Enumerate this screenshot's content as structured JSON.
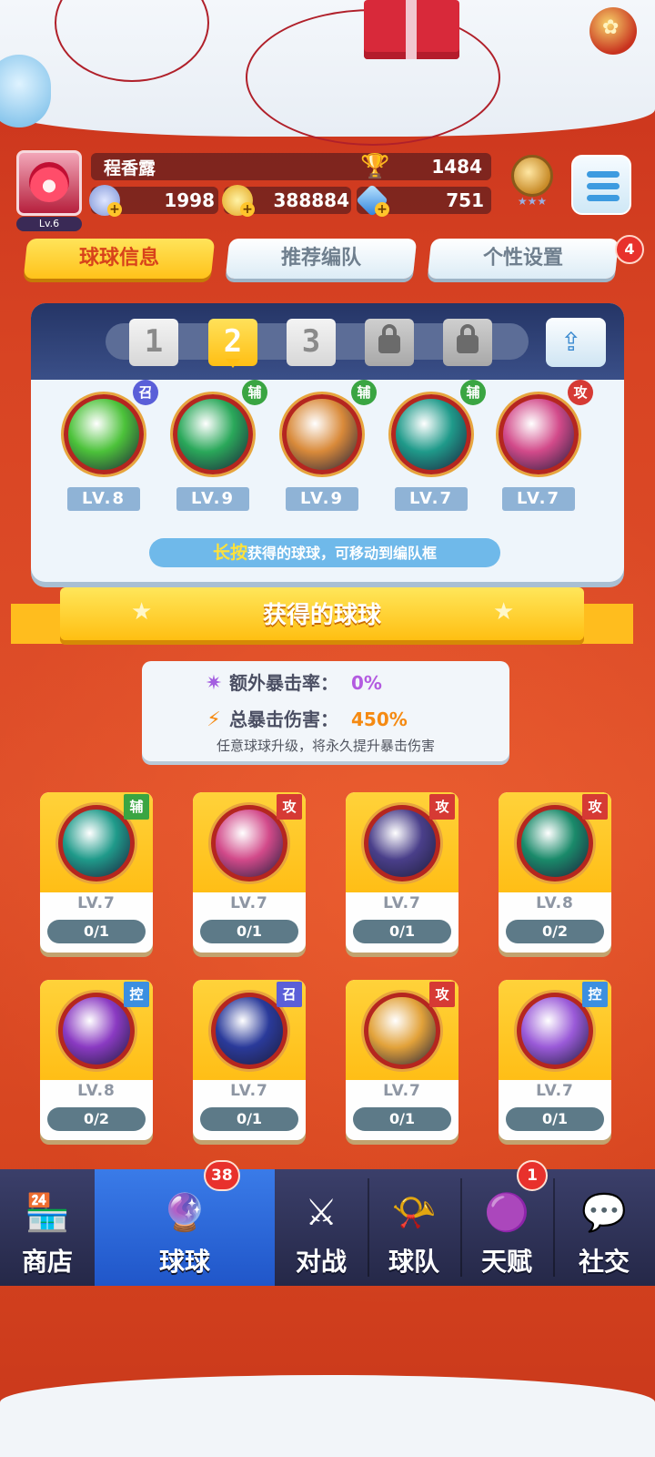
{
  "player": {
    "name": "程香露",
    "level": "Lv.6",
    "trophies": "1484"
  },
  "resources": [
    {
      "icon": "star-coin-icon",
      "value": "1998"
    },
    {
      "icon": "gold-coin-icon",
      "value": "388884"
    },
    {
      "icon": "diamond-icon",
      "value": "751"
    }
  ],
  "tabs": [
    {
      "label": "球球信息",
      "active": true
    },
    {
      "label": "推荐编队",
      "active": false
    },
    {
      "label": "个性设置",
      "active": false,
      "badge": "4"
    }
  ],
  "team": {
    "slots": [
      "1",
      "2",
      "3",
      "locked",
      "locked"
    ],
    "selected_slot": "2",
    "members": [
      {
        "role": "召",
        "level": "LV.8",
        "icon": "green-star-ball-icon",
        "color": "#4cc23a"
      },
      {
        "role": "辅",
        "level": "LV.9",
        "icon": "green-arrow-ball-icon",
        "color": "#2aa85a"
      },
      {
        "role": "辅",
        "level": "LV.9",
        "icon": "people-ball-icon",
        "color": "#d98a3a"
      },
      {
        "role": "辅",
        "level": "LV.7",
        "icon": "dragon-ball-icon",
        "color": "#1f9a8a"
      },
      {
        "role": "攻",
        "level": "LV.7",
        "icon": "prism-ball-icon",
        "color": "#d24a8a"
      }
    ],
    "hint_highlight": "长按",
    "hint_text": "获得的球球，可移动到编队框"
  },
  "section_title": "获得的球球",
  "crit": {
    "extra_rate_label": "额外暴击率：",
    "extra_rate_value": "0%",
    "total_damage_label": "总暴击伤害：",
    "total_damage_value": "450%",
    "note": "任意球球升级，将永久提升暴击伤害"
  },
  "balls": [
    {
      "tag": "辅",
      "level": "LV.7",
      "progress": "0/1",
      "icon": "dragon-ball-icon",
      "color": "#1f9a8a"
    },
    {
      "tag": "攻",
      "level": "LV.7",
      "progress": "0/1",
      "icon": "prism-ball-icon",
      "color": "#d24a8a"
    },
    {
      "tag": "攻",
      "level": "LV.7",
      "progress": "0/1",
      "icon": "venom-ball-icon",
      "color": "#4a3f8a"
    },
    {
      "tag": "攻",
      "level": "LV.8",
      "progress": "0/2",
      "icon": "crossbow-ball-icon",
      "color": "#1a8a6a"
    },
    {
      "tag": "控",
      "level": "LV.8",
      "progress": "0/2",
      "icon": "purple-rune-ball-icon",
      "color": "#8a3ac2"
    },
    {
      "tag": "召",
      "level": "LV.7",
      "progress": "0/1",
      "icon": "blackhole-ball-icon",
      "color": "#2a3a9a"
    },
    {
      "tag": "攻",
      "level": "LV.7",
      "progress": "0/1",
      "icon": "knight-ball-icon",
      "color": "#e2a23a"
    },
    {
      "tag": "控",
      "level": "LV.7",
      "progress": "0/1",
      "icon": "butterfly-ball-icon",
      "color": "#9a5ad8"
    }
  ],
  "nav": [
    {
      "label": "商店",
      "icon": "shop-icon",
      "active": false
    },
    {
      "label": "球球",
      "icon": "balls-icon",
      "active": true,
      "badge": "38"
    },
    {
      "label": "对战",
      "icon": "crossed-swords-icon",
      "active": false
    },
    {
      "label": "球队",
      "icon": "whistle-icon",
      "active": false
    },
    {
      "label": "天赋",
      "icon": "talent-orb-icon",
      "active": false,
      "badge": "1"
    },
    {
      "label": "社交",
      "icon": "chat-heart-icon",
      "active": false
    }
  ]
}
